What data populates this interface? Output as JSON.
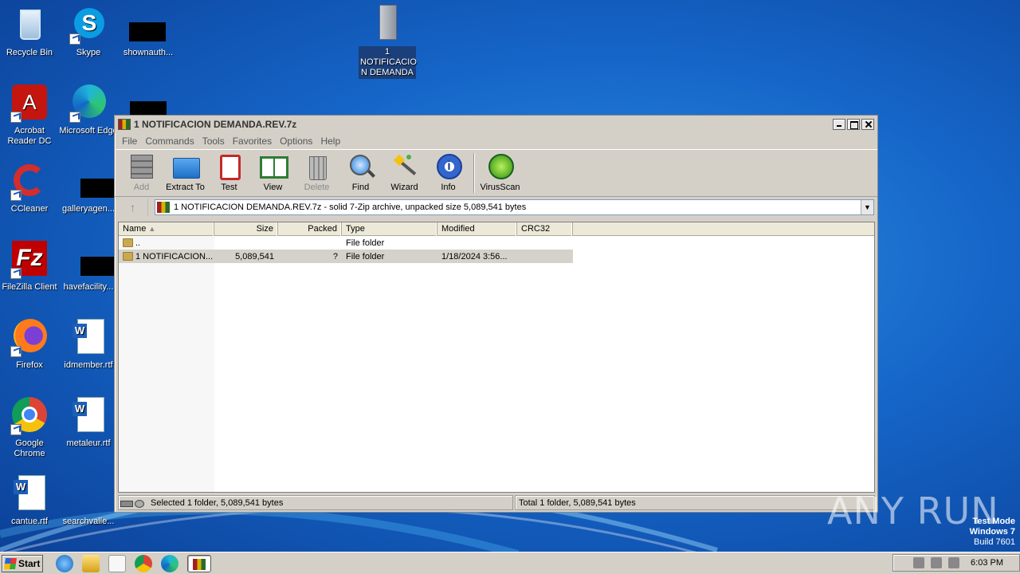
{
  "desktop": {
    "icons": [
      {
        "label": "Recycle Bin"
      },
      {
        "label": "Skype"
      },
      {
        "label": "shownauth..."
      },
      {
        "label": "Acrobat Reader DC"
      },
      {
        "label": "Microsoft Edge"
      },
      {
        "label": "CCleaner"
      },
      {
        "label": "galleryagen..."
      },
      {
        "label": "FileZilla Client"
      },
      {
        "label": "havefacility..."
      },
      {
        "label": "Firefox"
      },
      {
        "label": "idmember.rtf"
      },
      {
        "label": "Google Chrome"
      },
      {
        "label": "metaleur.rtf"
      },
      {
        "label": "cantue.rtf"
      },
      {
        "label": "searchvalle..."
      },
      {
        "label": "1 NOTIFICACIO N DEMANDA"
      }
    ]
  },
  "window": {
    "title": "1 NOTIFICACION DEMANDA.REV.7z",
    "menu": [
      "File",
      "Commands",
      "Tools",
      "Favorites",
      "Options",
      "Help"
    ],
    "toolbar": [
      {
        "label": "Add",
        "enabled": false
      },
      {
        "label": "Extract To",
        "enabled": true
      },
      {
        "label": "Test",
        "enabled": true
      },
      {
        "label": "View",
        "enabled": true
      },
      {
        "label": "Delete",
        "enabled": false
      },
      {
        "label": "Find",
        "enabled": true
      },
      {
        "label": "Wizard",
        "enabled": true
      },
      {
        "label": "Info",
        "enabled": true
      },
      {
        "label": "VirusScan",
        "enabled": true
      }
    ],
    "address": "1 NOTIFICACION DEMANDA.REV.7z - solid 7-Zip archive, unpacked size 5,089,541 bytes",
    "columns": [
      "Name",
      "Size",
      "Packed",
      "Type",
      "Modified",
      "CRC32"
    ],
    "rows": [
      {
        "name": "..",
        "size": "",
        "packed": "",
        "type": "File folder",
        "modified": "",
        "crc": ""
      },
      {
        "name": "1 NOTIFICACION...",
        "size": "5,089,541",
        "packed": "?",
        "type": "File folder",
        "modified": "1/18/2024 3:56...",
        "crc": ""
      }
    ],
    "status_left": "Selected 1 folder, 5,089,541 bytes",
    "status_right": "Total 1 folder, 5,089,541 bytes"
  },
  "taskbar": {
    "start_label": "Start",
    "clock": "6:03 PM"
  },
  "watermark": {
    "line1": "Test Mode",
    "line2": "Windows 7",
    "line3": "Build 7601",
    "brand": "ANY RUN"
  }
}
